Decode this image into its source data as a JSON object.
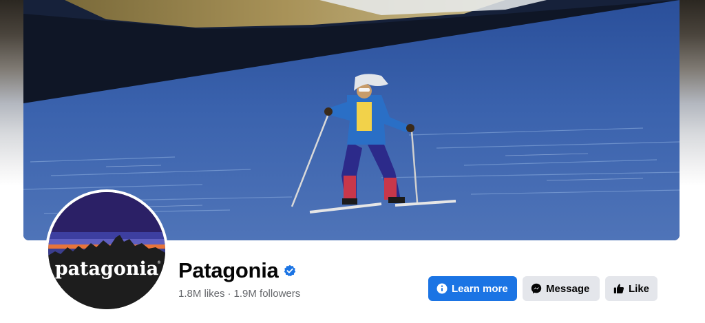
{
  "profile": {
    "name": "Patagonia",
    "verified": true,
    "likes": "1.8M likes",
    "separator": "·",
    "followers": "1.9M followers",
    "avatar_logo_text": "patagonia",
    "avatar_icon": "patagonia-logo"
  },
  "cover": {
    "subject": "skier-on-snow-slope"
  },
  "actions": {
    "learn_more_label": "Learn more",
    "learn_more_icon": "info-icon",
    "message_label": "Message",
    "message_icon": "messenger-icon",
    "like_label": "Like",
    "like_icon": "thumbs-up-icon"
  },
  "colors": {
    "primary_button": "#1b74e4",
    "secondary_button": "#e4e6eb",
    "verified_badge": "#1b74e4",
    "name_text": "#050505",
    "muted_text": "#65676b"
  }
}
